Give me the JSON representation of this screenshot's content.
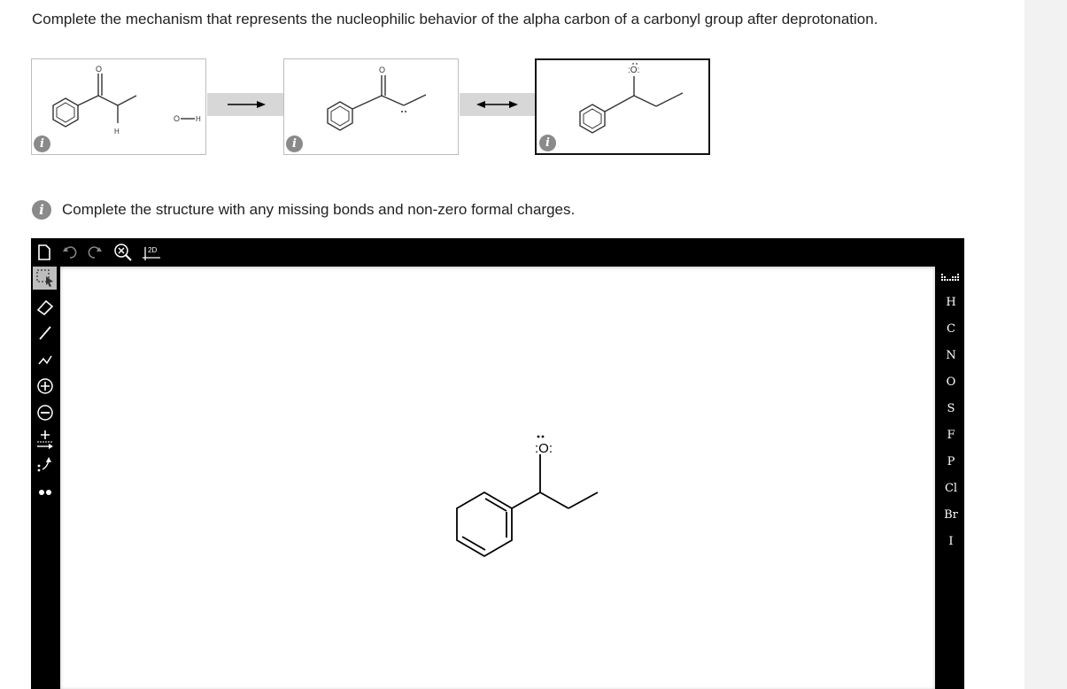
{
  "question": "Complete the mechanism that represents the nucleophilic behavior of the alpha carbon of a carbonyl group after deprotonation.",
  "mechanism": {
    "panel1": {
      "atom_o": "O",
      "atom_h": "H",
      "reagent": "O",
      "reagent_h": "H",
      "info_icon": "info-icon"
    },
    "panel2": {
      "atom_o": "O",
      "info_icon": "info-icon"
    },
    "panel3": {
      "atom_o": "O",
      "info_icon": "info-icon"
    },
    "arrow1": "reaction-arrow",
    "arrow2": "resonance-arrow"
  },
  "instruction": "Complete the structure with any missing bonds and non-zero formal charges.",
  "editor": {
    "top_toolbar": [
      "new-document-icon",
      "undo-icon",
      "redo-icon",
      "zoom-clear-icon",
      "clean-2d-icon"
    ],
    "clean_2d_label": "2D",
    "left_toolbar": [
      "select-icon",
      "eraser-icon",
      "single-bond-icon",
      "chain-icon",
      "positive-charge-icon",
      "negative-charge-icon",
      "charge-arrow-icon",
      "curved-arrow-icon",
      "lone-pair-icon"
    ],
    "canvas_atom": "O",
    "elements": [
      "H",
      "C",
      "N",
      "O",
      "S",
      "F",
      "P",
      "Cl",
      "Br",
      "I"
    ],
    "periodic_table_icon": "periodic-table-icon"
  },
  "colors": {
    "info": "#8a8a8a",
    "editor_bg": "#000000",
    "panel_border": "#bdbdbd",
    "arrow_box": "#d7d7d7"
  }
}
